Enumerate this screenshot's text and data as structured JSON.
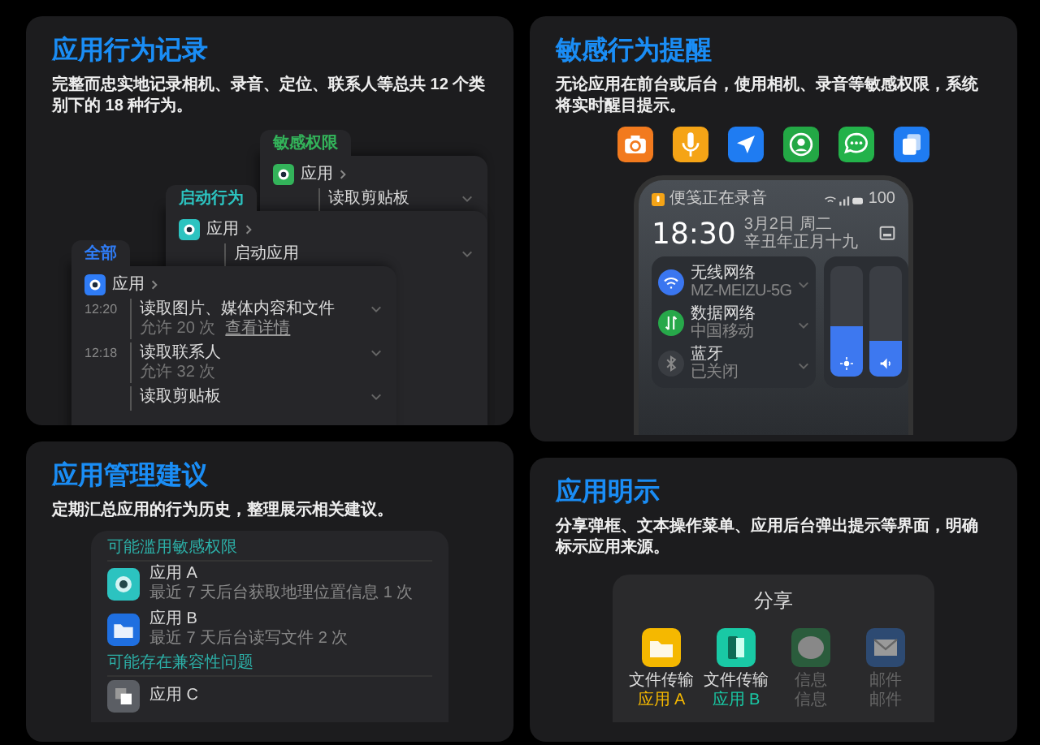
{
  "behavior_log": {
    "title": "应用行为记录",
    "description": "完整而忠实地记录相机、录音、定位、联系人等总共 12 个类别下的 18 种行为。",
    "panels": [
      {
        "tab": "敏感权限",
        "color": "#33b35a",
        "app": "应用",
        "items": [
          {
            "action": "读取剪贴板"
          }
        ]
      },
      {
        "tab": "启动行为",
        "color": "#2cc3c0",
        "app": "应用",
        "items": [
          {
            "action": "启动应用"
          }
        ]
      },
      {
        "tab": "全部",
        "color": "#2f7cf6",
        "app": "应用",
        "items": [
          {
            "time": "12:20",
            "action": "读取图片、媒体内容和文件",
            "detail": "允许 20 次",
            "link": "查看详情"
          },
          {
            "time": "12:18",
            "action": "读取联系人",
            "detail": "允许 32 次"
          },
          {
            "action": "读取剪贴板"
          }
        ]
      }
    ]
  },
  "sensitive_alerts": {
    "title": "敏感行为提醒",
    "description": "无论应用在前台或后台，使用相机、录音等敏感权限，系统将实时醒目提示。",
    "icons": [
      {
        "kind": "camera",
        "color": "#f27a1e"
      },
      {
        "kind": "mic",
        "color": "#f5a416"
      },
      {
        "kind": "location",
        "color": "#1f7cf2"
      },
      {
        "kind": "contact",
        "color": "#23a845"
      },
      {
        "kind": "message",
        "color": "#23b24a"
      },
      {
        "kind": "copy",
        "color": "#1f7cf2"
      }
    ],
    "phone": {
      "status_text": "便笺正在录音",
      "battery": "100",
      "time": "18:30",
      "date": "3月2日 周二",
      "lunar_date": "辛丑年正月十九",
      "toggles": [
        {
          "kind": "wifi",
          "name": "无线网络",
          "detail": "MZ-MEIZU-5G",
          "on": true,
          "color": "#3a76f0"
        },
        {
          "kind": "data",
          "name": "数据网络",
          "detail": "中国移动",
          "on": true,
          "color": "#27a84a"
        },
        {
          "kind": "bluetooth",
          "name": "蓝牙",
          "detail": "已关闭",
          "on": false
        }
      ],
      "sliders": [
        {
          "kind": "brightness",
          "level": 0.45
        },
        {
          "kind": "volume",
          "level": 0.33
        }
      ]
    }
  },
  "management_tips": {
    "title": "应用管理建议",
    "description": "定期汇总应用的行为历史，整理展示相关建议。",
    "groups": [
      {
        "heading": "可能滥用敏感权限",
        "apps": [
          {
            "kind": "target",
            "name": "应用 A",
            "detail": "最近 7 天后台获取地理位置信息 1 次",
            "color": "#2cc3c0"
          },
          {
            "kind": "folder",
            "name": "应用 B",
            "detail": "最近 7 天后台读写文件 2 次",
            "color": "#1f6fe0"
          }
        ]
      },
      {
        "heading": "可能存在兼容性问题",
        "apps": [
          {
            "kind": "window",
            "name": "应用 C",
            "color": "#5b5e64"
          }
        ]
      }
    ]
  },
  "app_attribution": {
    "title": "应用明示",
    "description": "分享弹框、文本操作菜单、应用后台弹出提示等界面，明确标示应用来源。",
    "sheet": {
      "title": "分享",
      "targets": [
        {
          "kind": "folder",
          "name": "文件传输",
          "source": "应用 A",
          "color": "#f5b800",
          "dimmed": false
        },
        {
          "kind": "device",
          "name": "文件传输",
          "source": "应用 B",
          "color": "#19c9a5",
          "dimmed": false
        },
        {
          "kind": "chat",
          "name": "信息",
          "source": "信息",
          "color": "#2a5c3c",
          "dimmed": true
        },
        {
          "kind": "mail",
          "name": "邮件",
          "source": "邮件",
          "color": "#2d4a72",
          "dimmed": true
        }
      ]
    }
  }
}
